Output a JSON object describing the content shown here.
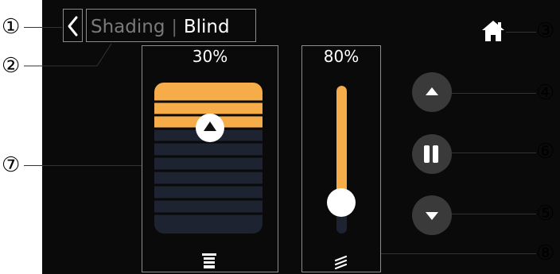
{
  "header": {
    "back_icon": "chevron-left-icon",
    "tab_inactive": "Shading",
    "separator": "|",
    "tab_active": "Blind",
    "home_icon": "home-icon"
  },
  "blind_panel": {
    "percent_label": "30%",
    "level_percent": 30,
    "knob_icon": "triangle-up-icon",
    "footer_icon": "blind-icon",
    "slat_count": 10
  },
  "tilt_panel": {
    "percent_label": "80%",
    "level_percent": 80,
    "footer_icon": "slats-angle-icon"
  },
  "controls": {
    "up_icon": "triangle-up-icon",
    "pause_icon": "pause-icon",
    "down_icon": "triangle-down-icon"
  },
  "callouts": {
    "c1": "①",
    "c2": "②",
    "c3": "③",
    "c4": "④",
    "c5": "⑤",
    "c6": "⑥",
    "c7": "⑦",
    "c8": "⑧"
  },
  "colors": {
    "accent": "#f7ac4a",
    "screen_bg": "#0a0a0a",
    "track": "#1d2330",
    "button": "#3a3a3a"
  }
}
